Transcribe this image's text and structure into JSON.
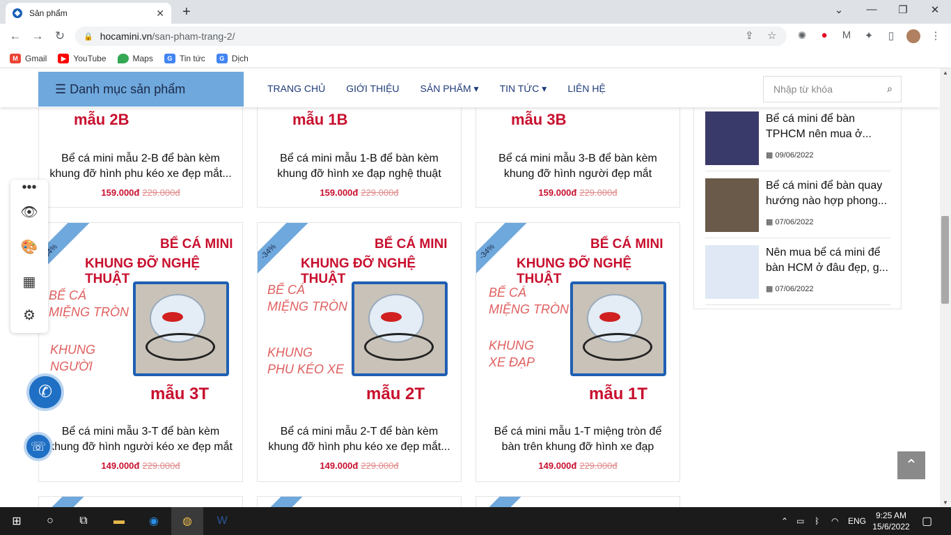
{
  "browser": {
    "tab_title": "Sản phẩm",
    "url_host": "hocamini.vn",
    "url_path": "/san-pham-trang-2/",
    "bookmarks": [
      "Gmail",
      "YouTube",
      "Maps",
      "Tin tức",
      "Dịch"
    ]
  },
  "site": {
    "category_button": "☰ Danh mục sản phẩm",
    "menu": [
      "TRANG CHỦ",
      "GIỚI THIỆU",
      "SẢN PHẨM ▾",
      "TIN TỨC ▾",
      "LIÊN HỆ"
    ],
    "search_placeholder": "Nhập từ khóa"
  },
  "products_top": [
    {
      "badge": "mẫu 2B",
      "title1": "Bể cá mini mẫu 2-B để bàn kèm",
      "title2": "khung đỡ hình phu kéo xe đẹp mắt...",
      "price": "159.000đ",
      "old_price": "229.000đ"
    },
    {
      "badge": "mẫu 1B",
      "title1": "Bể cá mini mẫu 1-B để bàn kèm",
      "title2": "khung đỡ hình xe đạp nghệ thuật",
      "price": "159.000đ",
      "old_price": "229.000đ"
    },
    {
      "badge": "mẫu 3B",
      "title1": "Bể cá mini mẫu 3-B để bàn kèm",
      "title2": "khung đỡ hình người đẹp mắt",
      "price": "159.000đ",
      "old_price": "229.000đ"
    }
  ],
  "products_mid": [
    {
      "discount": "-34%",
      "headline1": "BỂ CÁ MINI",
      "headline2": "KHUNG ĐỠ NGHỆ THUẬT",
      "label_a": "BỂ CÁ\nMIỆNG TRÒN",
      "label_b": "KHUNG\nNGƯỜI",
      "model": "mẫu 3T",
      "title1": "Bể cá mini mẫu 3-T để bàn kèm",
      "title2": "khung đỡ hình người kéo xe đẹp mắt",
      "price": "149.000đ",
      "old_price": "229.000đ"
    },
    {
      "discount": "-34%",
      "headline1": "BỂ CÁ MINI",
      "headline2": "KHUNG ĐỠ NGHỆ THUẬT",
      "label_a": "BỂ CÁ\nMIỆNG TRÒN",
      "label_b": "KHUNG\nPHU KÉO XE",
      "model": "mẫu 2T",
      "title1": "Bể cá mini mẫu 2-T để bàn kèm",
      "title2": "khung đỡ hình phu kéo xe đẹp mắt...",
      "price": "149.000đ",
      "old_price": "229.000đ"
    },
    {
      "discount": "-34%",
      "headline1": "BỂ CÁ MINI",
      "headline2": "KHUNG ĐỠ NGHỆ THUẬT",
      "label_a": "BỂ CÁ\nMIỆNG TRÒN",
      "label_b": "KHUNG\nXE ĐẠP",
      "model": "mẫu 1T",
      "title1": "Bể cá mini mẫu 1-T miệng tròn để",
      "title2": "bàn trên khung đỡ hình xe đạp",
      "price": "149.000đ",
      "old_price": "229.000đ"
    }
  ],
  "sidebar_posts": [
    {
      "title1": "Bể cá mini để bàn",
      "title2": "TPHCM nên mua ở...",
      "date": "09/06/2022"
    },
    {
      "title1": "Bể cá mini để bàn quay",
      "title2": "hướng nào hợp phong...",
      "date": "07/06/2022"
    },
    {
      "title1": "Nên mua bể cá mini để",
      "title2": "bàn HCM ở đâu đẹp, g...",
      "date": "07/06/2022"
    }
  ],
  "taskbar": {
    "lang": "ENG",
    "time": "9:25 AM",
    "date": "15/6/2022"
  }
}
